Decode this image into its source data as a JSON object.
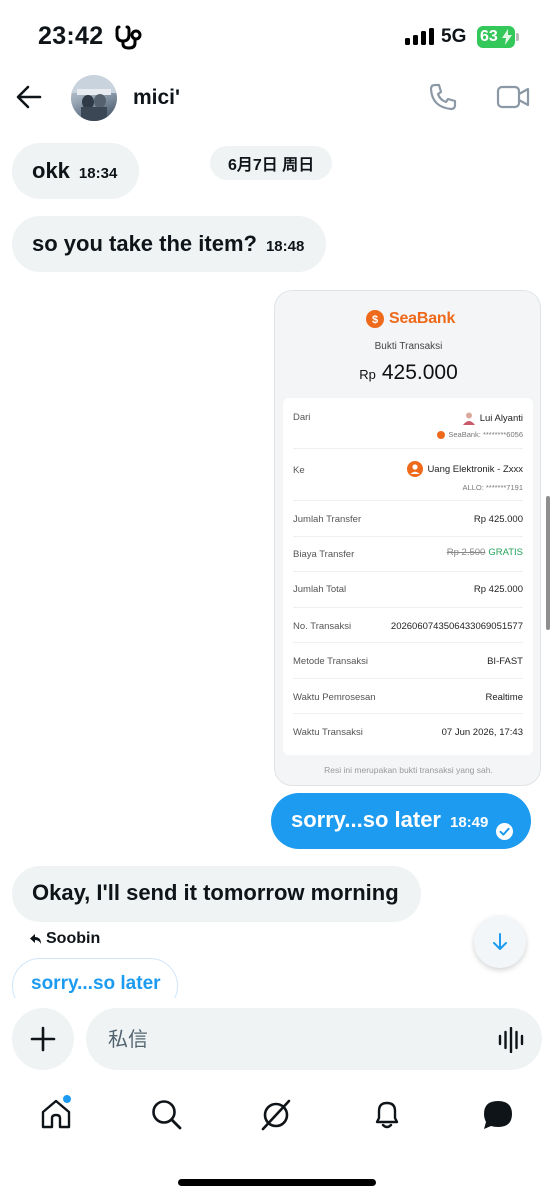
{
  "status_bar": {
    "time": "23:42",
    "network": "5G",
    "battery": "63"
  },
  "header": {
    "name": "mici'"
  },
  "date_separator": "6月7日 周日",
  "messages": [
    {
      "text": "okk",
      "time": "18:34"
    },
    {
      "text": "so you take the item?",
      "time": "18:48"
    },
    {
      "text": "sorry...so later",
      "time": "18:49"
    },
    {
      "text": "Okay, I'll send it tomorrow morning"
    }
  ],
  "receipt": {
    "brand": "SeaBank",
    "subtitle": "Bukti Transaksi",
    "currency": "Rp",
    "amount": "425.000",
    "from_label": "Dari",
    "from_name": "Lui Alyanti",
    "from_account": "SeaBank: ********6056",
    "to_label": "Ke",
    "to_name": "Uang Elektronik - Zxxx",
    "to_account": "ALLO: *******7191",
    "rows": [
      {
        "label": "Jumlah Transfer",
        "value": "Rp 425.000"
      },
      {
        "label": "Biaya Transfer",
        "strike": "Rp 2.500",
        "value": "GRATIS"
      },
      {
        "label": "Jumlah Total",
        "value": "Rp 425.000"
      },
      {
        "label": "No. Transaksi",
        "value": "20260607435064330690515​77"
      },
      {
        "label": "Metode Transaksi",
        "value": "BI-FAST"
      },
      {
        "label": "Waktu Pemrosesan",
        "value": "Realtime"
      },
      {
        "label": "Waktu Transaksi",
        "value": "07 Jun 2026, 17:43"
      }
    ],
    "footer": "Resi ini merupakan bukti transaksi yang sah."
  },
  "reply": {
    "name": "Soobin",
    "quoted": "sorry...so later"
  },
  "composer": {
    "placeholder": "私信"
  },
  "colors": {
    "accent": "#1d9bf0",
    "bubble_in": "#eff3f4",
    "seabank": "#ee6a1a",
    "gratis": "#25a35a",
    "battery": "#34c759"
  },
  "tabs": [
    "home-icon",
    "search-icon",
    "grok-icon",
    "notifications-icon",
    "messages-icon"
  ]
}
